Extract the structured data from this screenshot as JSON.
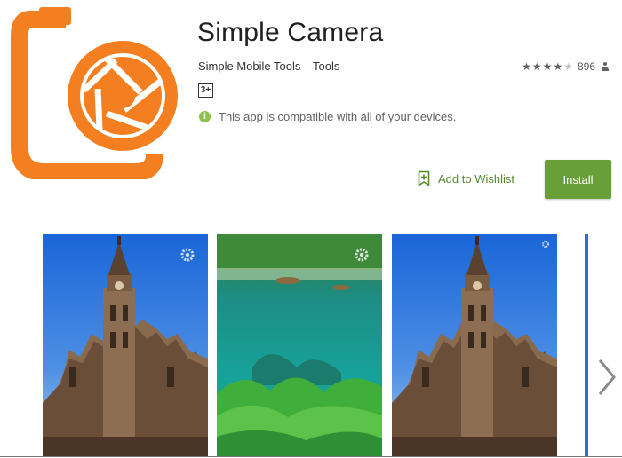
{
  "app": {
    "title": "Simple Camera",
    "developer": "Simple Mobile Tools",
    "category": "Tools",
    "content_rating": "3+",
    "compatibility": "This app is compatible with all of your devices.",
    "rating_value": 4,
    "rating_count": "896"
  },
  "actions": {
    "wishlist_label": "Add to Wishlist",
    "install_label": "Install"
  },
  "screenshots": [
    {
      "subject": "cathedral-tower"
    },
    {
      "subject": "underwater-plants"
    },
    {
      "subject": "cathedral-tower"
    },
    {
      "subject": "partial"
    }
  ],
  "colors": {
    "brand_orange": "#f47f20",
    "install_green": "#689f38",
    "wishlist_green": "#558b2f",
    "info_green": "#8bc34a"
  },
  "icons": [
    "camera-logo-icon",
    "star-icon",
    "person-icon",
    "info-icon",
    "bookmark-plus-icon",
    "settings-gear-icon",
    "chevron-right-icon"
  ]
}
